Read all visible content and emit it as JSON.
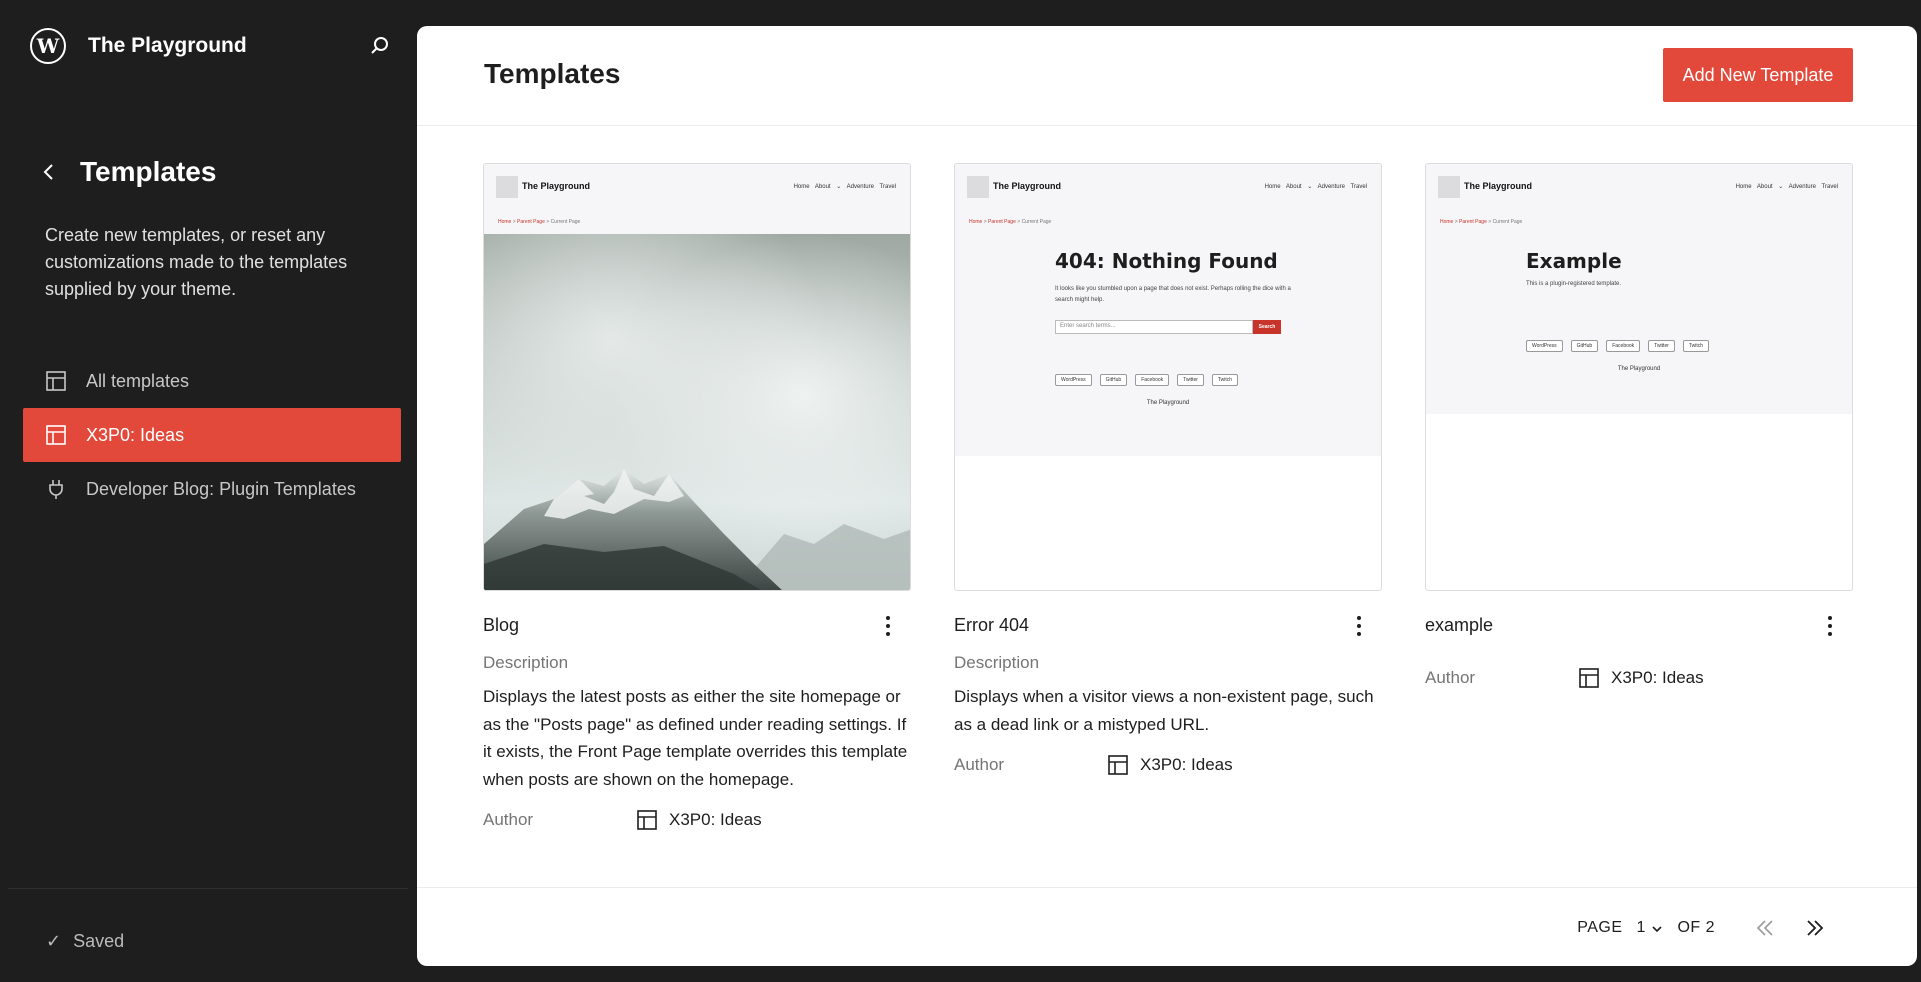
{
  "sidebar": {
    "site_title": "The Playground",
    "nav_title": "Templates",
    "description": "Create new templates, or reset any customizations made to the templates supplied by your theme.",
    "items": [
      {
        "label": "All templates",
        "icon": "layout-icon",
        "active": false
      },
      {
        "label": "X3P0: Ideas",
        "icon": "layout-icon",
        "active": true
      },
      {
        "label": "Developer Blog: Plugin Templates",
        "icon": "plugin-icon",
        "active": false
      }
    ],
    "saved_label": "Saved"
  },
  "header": {
    "title": "Templates",
    "add_button": "Add New Template"
  },
  "cards": [
    {
      "title": "Blog",
      "description_label": "Description",
      "description": "Displays the latest posts as either the site homepage or as the \"Posts page\" as defined under reading settings. If it exists, the Front Page template overrides this template when posts are shown on the homepage.",
      "author_label": "Author",
      "author": "X3P0: Ideas",
      "preview": {
        "site": "The Playground",
        "nav": "Home About ⌄ Adventure Travel",
        "crumb_home": "Home",
        "crumb_parent": "Parent Page",
        "crumb_current": "Current Page"
      }
    },
    {
      "title": "Error 404",
      "description_label": "Description",
      "description": "Displays when a visitor views a non-existent page, such as a dead link or a mistyped URL.",
      "author_label": "Author",
      "author": "X3P0: Ideas",
      "preview": {
        "site": "The Playground",
        "nav": "Home About ⌄ Adventure Travel",
        "crumb_home": "Home",
        "crumb_parent": "Parent Page",
        "crumb_current": "Current Page",
        "heading": "404: Nothing Found",
        "text": "It looks like you stumbled upon a page that does not exist. Perhaps rolling the dice with a search might help.",
        "search_placeholder": "Enter search terms...",
        "search_button": "Search",
        "socials": [
          "WordPress",
          "GitHub",
          "Facebook",
          "Twitter",
          "Twitch"
        ],
        "footer": "The Playground"
      }
    },
    {
      "title": "example",
      "author_label": "Author",
      "author": "X3P0: Ideas",
      "preview": {
        "site": "The Playground",
        "nav": "Home About ⌄ Adventure Travel",
        "crumb_home": "Home",
        "crumb_parent": "Parent Page",
        "crumb_current": "Current Page",
        "heading": "Example",
        "text": "This is a plugin-registered template.",
        "socials": [
          "WordPress",
          "GitHub",
          "Facebook",
          "Twitter",
          "Twitch"
        ],
        "footer": "The Playground"
      }
    }
  ],
  "pagination": {
    "page_label": "PAGE",
    "current_page": "1",
    "of_label": "OF 2"
  },
  "colors": {
    "accent": "#e2493b",
    "sidebar_bg": "#1e1e1e"
  }
}
